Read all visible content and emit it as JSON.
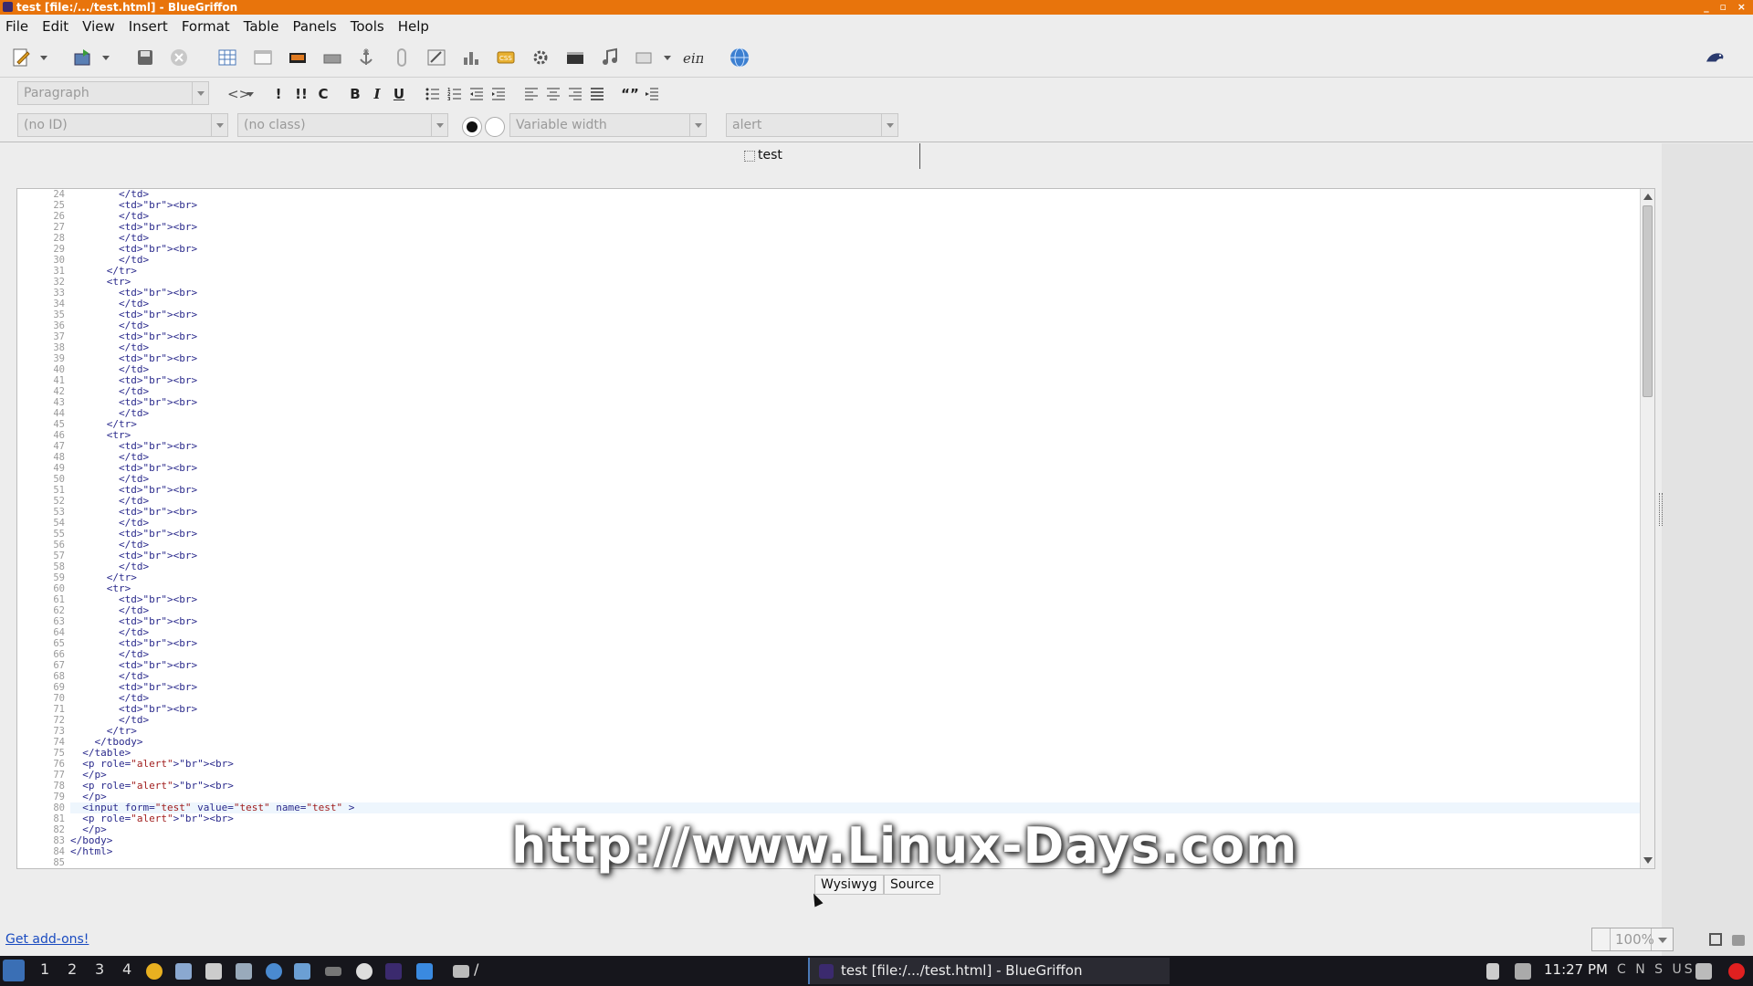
{
  "window": {
    "title": "test [file:/.../test.html] - BlueGriffon",
    "controls": "_ ▫ ×"
  },
  "menu": [
    "File",
    "Edit",
    "View",
    "Insert",
    "Format",
    "Table",
    "Panels",
    "Tools",
    "Help"
  ],
  "format_bar": {
    "paragraph_format": "Paragraph",
    "code_toggle": "<>",
    "emphasis": "!",
    "strong": "!!",
    "code": "C",
    "bold": "B",
    "italic": "I",
    "underline": "U",
    "quote": "“”"
  },
  "style_bar": {
    "id_placeholder": "(no ID)",
    "class_placeholder": "(no class)",
    "font": "Variable width",
    "role": "alert"
  },
  "tabs": [
    {
      "label": "test"
    }
  ],
  "source": {
    "lines": [
      {
        "n": "24",
        "text": "        </td>"
      },
      {
        "n": "25",
        "text": "        <td><br>"
      },
      {
        "n": "26",
        "text": "        </td>"
      },
      {
        "n": "27",
        "text": "        <td><br>"
      },
      {
        "n": "28",
        "text": "        </td>"
      },
      {
        "n": "29",
        "text": "        <td><br>"
      },
      {
        "n": "30",
        "text": "        </td>"
      },
      {
        "n": "31",
        "text": "      </tr>"
      },
      {
        "n": "32",
        "text": "      <tr>"
      },
      {
        "n": "33",
        "text": "        <td><br>"
      },
      {
        "n": "34",
        "text": "        </td>"
      },
      {
        "n": "35",
        "text": "        <td><br>"
      },
      {
        "n": "36",
        "text": "        </td>"
      },
      {
        "n": "37",
        "text": "        <td><br>"
      },
      {
        "n": "38",
        "text": "        </td>"
      },
      {
        "n": "39",
        "text": "        <td><br>"
      },
      {
        "n": "40",
        "text": "        </td>"
      },
      {
        "n": "41",
        "text": "        <td><br>"
      },
      {
        "n": "42",
        "text": "        </td>"
      },
      {
        "n": "43",
        "text": "        <td><br>"
      },
      {
        "n": "44",
        "text": "        </td>"
      },
      {
        "n": "45",
        "text": "      </tr>"
      },
      {
        "n": "46",
        "text": "      <tr>"
      },
      {
        "n": "47",
        "text": "        <td><br>"
      },
      {
        "n": "48",
        "text": "        </td>"
      },
      {
        "n": "49",
        "text": "        <td><br>"
      },
      {
        "n": "50",
        "text": "        </td>"
      },
      {
        "n": "51",
        "text": "        <td><br>"
      },
      {
        "n": "52",
        "text": "        </td>"
      },
      {
        "n": "53",
        "text": "        <td><br>"
      },
      {
        "n": "54",
        "text": "        </td>"
      },
      {
        "n": "55",
        "text": "        <td><br>"
      },
      {
        "n": "56",
        "text": "        </td>"
      },
      {
        "n": "57",
        "text": "        <td><br>"
      },
      {
        "n": "58",
        "text": "        </td>"
      },
      {
        "n": "59",
        "text": "      </tr>"
      },
      {
        "n": "60",
        "text": "      <tr>"
      },
      {
        "n": "61",
        "text": "        <td><br>"
      },
      {
        "n": "62",
        "text": "        </td>"
      },
      {
        "n": "63",
        "text": "        <td><br>"
      },
      {
        "n": "64",
        "text": "        </td>"
      },
      {
        "n": "65",
        "text": "        <td><br>"
      },
      {
        "n": "66",
        "text": "        </td>"
      },
      {
        "n": "67",
        "text": "        <td><br>"
      },
      {
        "n": "68",
        "text": "        </td>"
      },
      {
        "n": "69",
        "text": "        <td><br>"
      },
      {
        "n": "70",
        "text": "        </td>"
      },
      {
        "n": "71",
        "text": "        <td><br>"
      },
      {
        "n": "72",
        "text": "        </td>"
      },
      {
        "n": "73",
        "text": "      </tr>"
      },
      {
        "n": "74",
        "text": "    </tbody>"
      },
      {
        "n": "75",
        "text": "  </table>"
      },
      {
        "n": "76",
        "text": "  <p role=\"alert\"><br>"
      },
      {
        "n": "77",
        "text": "  </p>"
      },
      {
        "n": "78",
        "text": "  <p role=\"alert\"><br>"
      },
      {
        "n": "79",
        "text": "  </p>"
      },
      {
        "n": "80",
        "text": "  <input form=\"test\" value=\"test\" name=\"test\" >",
        "active": true
      },
      {
        "n": "81",
        "text": "  <p role=\"alert\"><br>"
      },
      {
        "n": "82",
        "text": "  </p>"
      },
      {
        "n": "83",
        "text": "</body>"
      },
      {
        "n": "84",
        "text": "</html>"
      },
      {
        "n": "85",
        "text": ""
      }
    ]
  },
  "watermark": "http://www.Linux-Days.com",
  "modes": {
    "wysiwyg": "Wysiwyg",
    "source": "Source"
  },
  "status": {
    "addons_link": "Get add-ons!",
    "zoom": "100%"
  },
  "taskbar": {
    "workspaces": [
      "1",
      "2",
      "3",
      "4"
    ],
    "window_task": "test [file:/.../test.html] - BlueGriffon",
    "path_label": "/",
    "clock": "11:27 PM",
    "keyboard": "C N S US"
  },
  "colors": {
    "titlebar": "#e8740c",
    "code_tag": "#2a2a8c",
    "code_value": "#a11e1e",
    "link": "#1a4bc0"
  }
}
